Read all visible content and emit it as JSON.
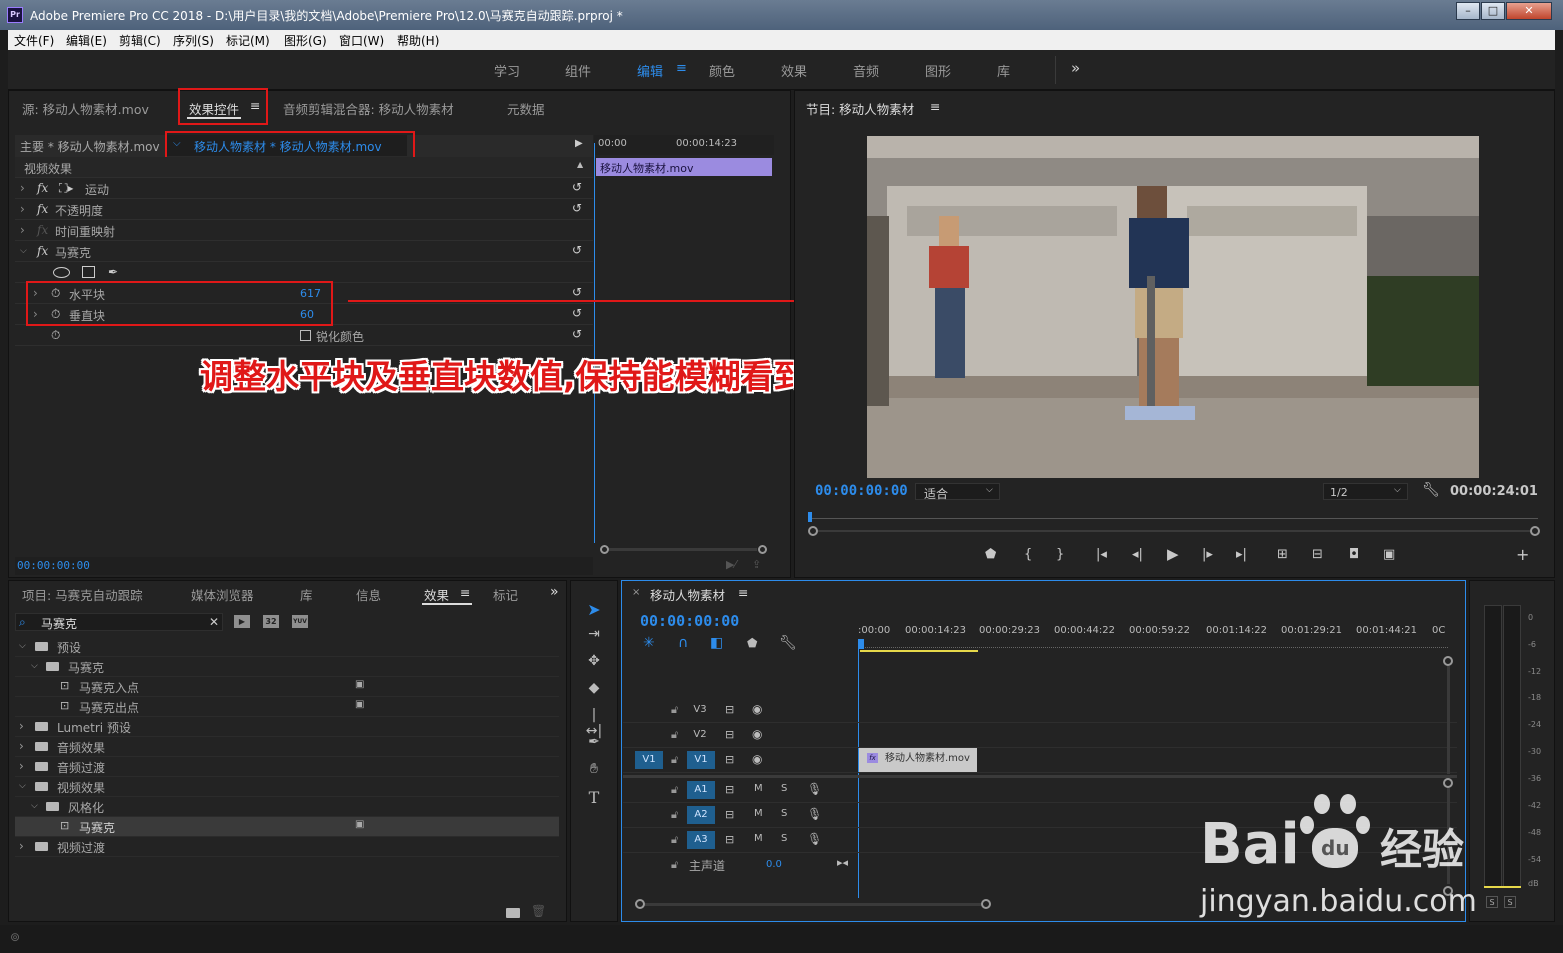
{
  "window": {
    "title": "Adobe Premiere Pro CC 2018 - D:\\用户目录\\我的文档\\Adobe\\Premiere Pro\\12.0\\马赛克自动跟踪.prproj *",
    "logo": "Pr"
  },
  "menu": [
    "文件(F)",
    "编辑(E)",
    "剪辑(C)",
    "序列(S)",
    "标记(M)",
    "图形(G)",
    "窗口(W)",
    "帮助(H)"
  ],
  "workspaces": [
    "学习",
    "组件",
    "编辑",
    "颜色",
    "效果",
    "音频",
    "图形",
    "库"
  ],
  "workspace_more": "»",
  "source_panel": {
    "tabs": [
      "源: 移动人物素材.mov",
      "效果控件",
      "音频剪辑混合器: 移动人物素材",
      "元数据"
    ],
    "master_label": "主要 * 移动人物素材.mov",
    "clip_label": "移动人物素材 * 移动人物素材.mov",
    "ruler": [
      "00:00",
      "00:00:14:23"
    ],
    "clip_bar": "移动人物素材.mov",
    "section": "视频效果",
    "timecode": "00:00:00:00"
  },
  "effects": [
    {
      "name": "运动"
    },
    {
      "name": "不透明度"
    },
    {
      "name": "时间重映射"
    },
    {
      "name": "马赛克"
    }
  ],
  "mosaic": {
    "h_label": "水平块",
    "h_value": "617",
    "v_label": "垂直块",
    "v_value": "60",
    "sharpen": "锐化颜色"
  },
  "annotation": "调整水平块及垂直块数值,保持能模糊看到视频即可",
  "program": {
    "title": "节目: 移动人物素材",
    "timecode": "00:00:00:00",
    "fit": "适合",
    "quality": "1/2",
    "duration": "00:00:24:01"
  },
  "project_panel": {
    "tabs": [
      "项目: 马赛克自动跟踪",
      "媒体浏览器",
      "库",
      "信息",
      "效果",
      "标记"
    ],
    "search_value": "马赛克",
    "badges": [
      "32",
      "YUV"
    ]
  },
  "effects_tree": [
    {
      "label": "预设",
      "indent": 0,
      "open": true
    },
    {
      "label": "马赛克",
      "indent": 1,
      "open": true
    },
    {
      "label": "马赛克入点",
      "indent": 2,
      "leaf": true
    },
    {
      "label": "马赛克出点",
      "indent": 2,
      "leaf": true
    },
    {
      "label": "Lumetri 预设",
      "indent": 0
    },
    {
      "label": "音频效果",
      "indent": 0
    },
    {
      "label": "音频过渡",
      "indent": 0
    },
    {
      "label": "视频效果",
      "indent": 0,
      "open": true
    },
    {
      "label": "风格化",
      "indent": 1,
      "open": true
    },
    {
      "label": "马赛克",
      "indent": 2,
      "leaf": true,
      "selected": true
    },
    {
      "label": "视频过渡",
      "indent": 0
    }
  ],
  "timeline": {
    "title": "移动人物素材",
    "timecode": "00:00:00:00",
    "ruler": [
      ":00:00",
      "00:00:14:23",
      "00:00:29:23",
      "00:00:44:22",
      "00:00:59:22",
      "00:01:14:22",
      "00:01:29:21",
      "00:01:44:21",
      "0C"
    ],
    "video_tracks": [
      "V3",
      "V2",
      "V1"
    ],
    "audio_tracks": [
      "A1",
      "A2",
      "A3"
    ],
    "source_patch": "V1",
    "clip": "移动人物素材.mov",
    "master": "主声道",
    "master_value": "0.0",
    "m": "M",
    "s": "S"
  },
  "meter": {
    "labels": [
      "0",
      "-6",
      "-12",
      "-18",
      "-24",
      "-30",
      "-36",
      "-42",
      "-48",
      "-54",
      "dB"
    ],
    "solo": "S"
  },
  "watermark": {
    "brand": "Bai",
    "du": "du",
    "jingyan": "经验",
    "url": "jingyan.baidu.com"
  },
  "colors": {
    "accent": "#2d8ceb",
    "annotation": "#e01818",
    "clip_purple": "#9b8be0"
  }
}
